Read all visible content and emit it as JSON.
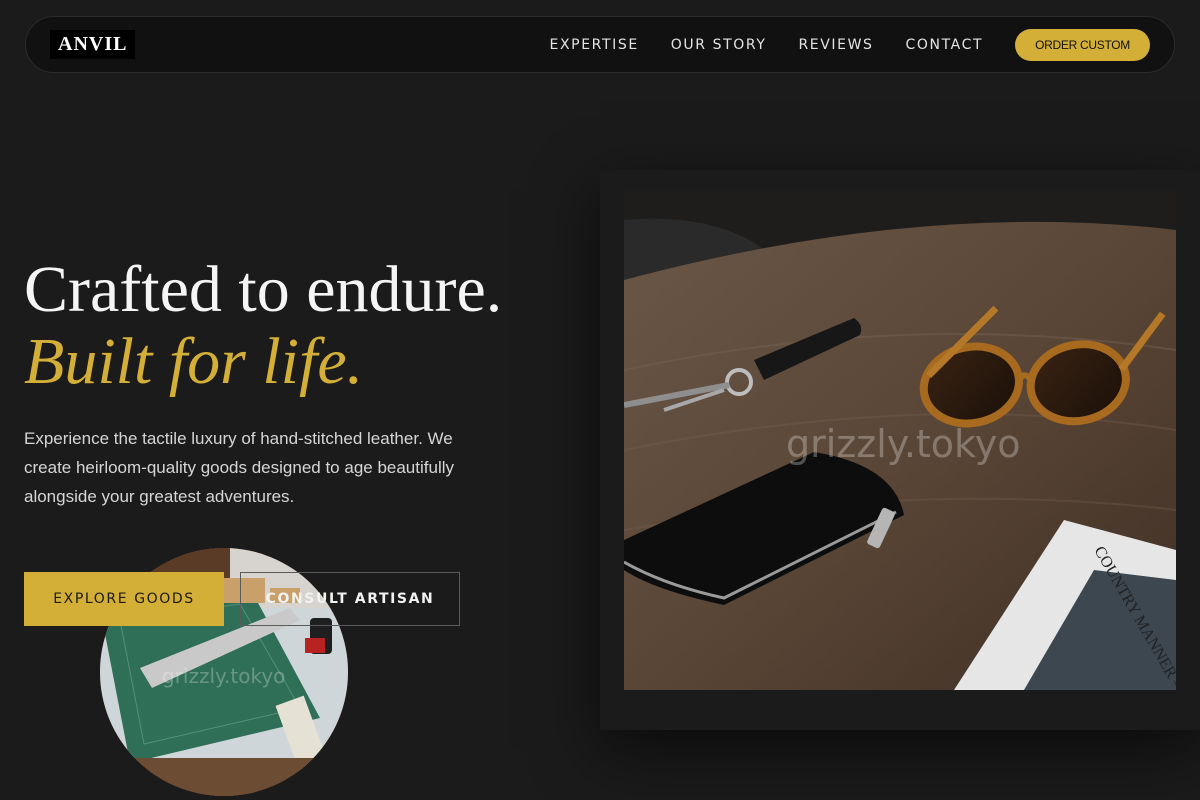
{
  "nav": {
    "logo": "ANVIL",
    "links": [
      "EXPERTISE",
      "OUR STORY",
      "REVIEWS",
      "CONTACT"
    ],
    "cta": "ORDER CUSTOM"
  },
  "hero": {
    "headline": "Crafted to endure.",
    "headline_accent": "Built for life.",
    "lead": "Experience the tactile luxury of hand-stitched leather. We create heirloom-quality goods designed to age beautifully alongside your greatest adventures.",
    "primary_button": "EXPLORE GOODS",
    "secondary_button": "CONSULT ARTISAN"
  },
  "photos": {
    "main_watermark": "grizzly.tokyo",
    "circle_watermark": "grizzly.tokyo",
    "magazine_text": "COUNTRY MANNER — Tokyo"
  },
  "colors": {
    "accent": "#d4af37",
    "background": "#1b1b1b",
    "nav_background": "#111111"
  }
}
